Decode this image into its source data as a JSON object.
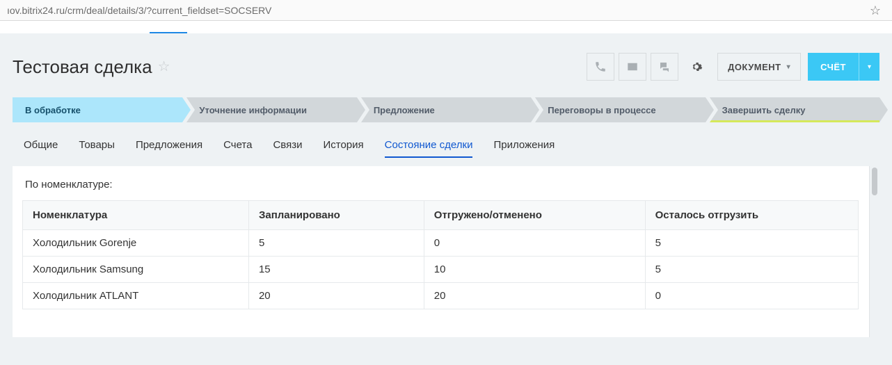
{
  "address_bar": "ıov.bitrix24.ru/crm/deal/details/3/?current_fieldset=SOCSERV",
  "page_title": "Тестовая сделка",
  "header_buttons": {
    "document_label": "ДОКУМЕНТ",
    "invoice_label": "СЧЁТ"
  },
  "stages": [
    {
      "label": "В обработке",
      "active": true
    },
    {
      "label": "Уточнение информации"
    },
    {
      "label": "Предложение"
    },
    {
      "label": "Переговоры в процессе"
    },
    {
      "label": "Завершить сделку",
      "final": true
    }
  ],
  "tabs": [
    {
      "label": "Общие"
    },
    {
      "label": "Товары"
    },
    {
      "label": "Предложения"
    },
    {
      "label": "Счета"
    },
    {
      "label": "Связи"
    },
    {
      "label": "История"
    },
    {
      "label": "Состояние сделки",
      "active": true
    },
    {
      "label": "Приложения"
    }
  ],
  "section": {
    "title": "По номенклатуре:",
    "columns": [
      "Номенклатура",
      "Запланировано",
      "Отгружено/отменено",
      "Осталось отгрузить"
    ],
    "rows": [
      {
        "name": "Холодильник Gorenje",
        "planned": "5",
        "shipped": "0",
        "remaining": "5"
      },
      {
        "name": "Холодильник Samsung",
        "planned": "15",
        "shipped": "10",
        "remaining": "5"
      },
      {
        "name": "Холодильник ATLANT",
        "planned": "20",
        "shipped": "20",
        "remaining": "0"
      }
    ]
  }
}
